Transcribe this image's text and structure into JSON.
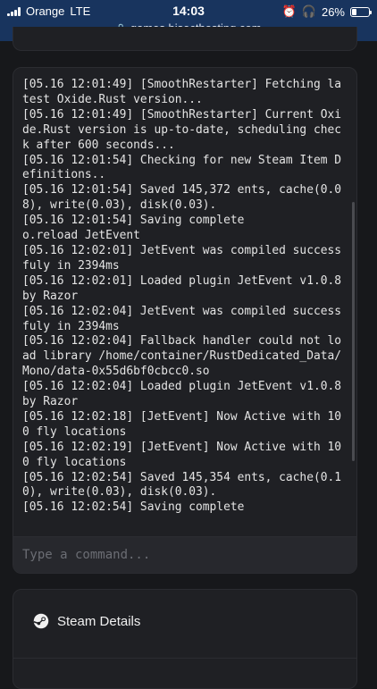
{
  "status_bar": {
    "carrier": "Orange",
    "network": "LTE",
    "time": "14:03",
    "battery": "26%",
    "battery_level": 0.26,
    "url": "games.bisecthosting.com"
  },
  "console": {
    "lines": [
      "[05.16 12:01:49] [SmoothRestarter] Fetching latest Oxide.Rust version...",
      "[05.16 12:01:49] [SmoothRestarter] Current Oxide.Rust version is up-to-date, scheduling check after 600 seconds...",
      "[05.16 12:01:54] Checking for new Steam Item Definitions..",
      "[05.16 12:01:54] Saved 145,372 ents, cache(0.08), write(0.03), disk(0.03).",
      "[05.16 12:01:54] Saving complete",
      "o.reload JetEvent",
      "[05.16 12:02:01] JetEvent was compiled successfuly in 2394ms",
      "[05.16 12:02:01] Loaded plugin JetEvent v1.0.8 by Razor",
      "[05.16 12:02:04] JetEvent was compiled successfuly in 2394ms",
      "[05.16 12:02:04] Fallback handler could not load library /home/container/RustDedicated_Data/Mono/data-0x55d6bf0cbcc0.so",
      "[05.16 12:02:04] Loaded plugin JetEvent v1.0.8 by Razor",
      "[05.16 12:02:18] [JetEvent] Now Active with 100 fly locations",
      "[05.16 12:02:19] [JetEvent] Now Active with 100 fly locations",
      "[05.16 12:02:54] Saved 145,354 ents, cache(0.10), write(0.03), disk(0.03).",
      "[05.16 12:02:54] Saving complete"
    ],
    "command_placeholder": "Type a command..."
  },
  "steam_details": {
    "title": "Steam Details",
    "icon": "steam-icon"
  }
}
